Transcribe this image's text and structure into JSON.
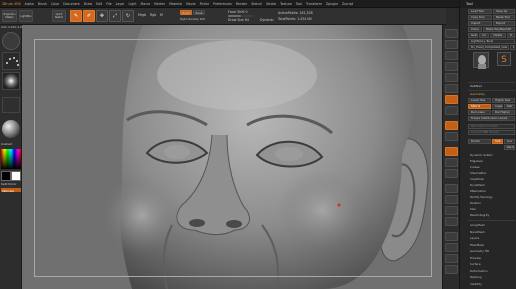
{
  "menubar": {
    "app_label": "ZBrush 4R6",
    "items": [
      "Alpha",
      "Brush",
      "Color",
      "Document",
      "Draw",
      "Edit",
      "File",
      "Layer",
      "Light",
      "Macro",
      "Marker",
      "Material",
      "Movie",
      "Picker",
      "Preferences",
      "Render",
      "Stencil",
      "Stroke",
      "Texture",
      "Tool",
      "Transform",
      "Zplugin",
      "Zscript"
    ]
  },
  "toolbar": {
    "projection_master": "Projection Master",
    "lightbox": "LightBox",
    "quick_sketch": "Quick Sketch",
    "edit": "Edit",
    "draw": "Draw",
    "move": "Move",
    "scale": "Scale",
    "rotate": "Rotate",
    "mrgb": "Mrgb",
    "rgb": "Rgb",
    "m": "M",
    "zadd": "Zadd",
    "zsub": "Zsub",
    "focal_shift": "Focal Shift 0",
    "z_intensity": "Z Intensity 25",
    "draw_size": "Draw Size 64",
    "dynamic": "Dynamic",
    "active_points": "ActivePoints: 181,528",
    "total_points": "TotalPoints: 1.434 Mil",
    "rgb_intensity": "Rgb Intensity 100"
  },
  "left": {
    "coords": "0.01, 0.019, 0.008",
    "gradient": "Gradient",
    "switch_color": "SwitchColor",
    "alternate": "Alternate"
  },
  "tray": {
    "title": "Tool",
    "row1": [
      "Load Tool",
      "Save As"
    ],
    "row2": [
      "Copy Tool",
      "Paste Tool"
    ],
    "row3": [
      "Import",
      "Export"
    ],
    "row4": [
      "Clone",
      "Make PolyMesh3D"
    ],
    "row5": [
      "GoZ",
      "All",
      "Visible",
      "R"
    ],
    "lightbox_tools": "Lightbox ▸ Tools",
    "current_tool": "Dv_Head_Completed_Low",
    "r_label": "R",
    "subtool": "SubTool",
    "geometry": "Geometry",
    "lower_res": "Lower Res",
    "higher_res": "Higher Res",
    "sdiv": "SDiv 6",
    "cage": "Cage",
    "rstr": "Rstr",
    "del_lower": "Del Lower",
    "del_higher": "Del Higher",
    "freeze_subdivision": "Freeze SubDivision Levels",
    "reconstruct_subdiv": "Reconstruct Subdiv",
    "convert_bpr": "Convert BPR To Geo",
    "divide": "Divide",
    "smt": "Smt",
    "suv": "Suv",
    "relx": "ReUV",
    "sections": [
      "Dynamic Subdiv",
      "Edgeloop",
      "Crease",
      "ShadowBox",
      "ClayPolish",
      "DynaMesh",
      "ZRemesher",
      "Modify Topology",
      "Position",
      "Size",
      "MeshIntegrity"
    ],
    "sections2": [
      "ArrayMesh",
      "NanoMesh",
      "Layers",
      "FiberMesh",
      "Geometry HD",
      "Preview",
      "Surface",
      "Deformation",
      "Masking",
      "Visibility"
    ]
  },
  "colors": {
    "accent": "#d2691e",
    "canvas_bg": "#6e6e6e",
    "panel": "#262626"
  }
}
